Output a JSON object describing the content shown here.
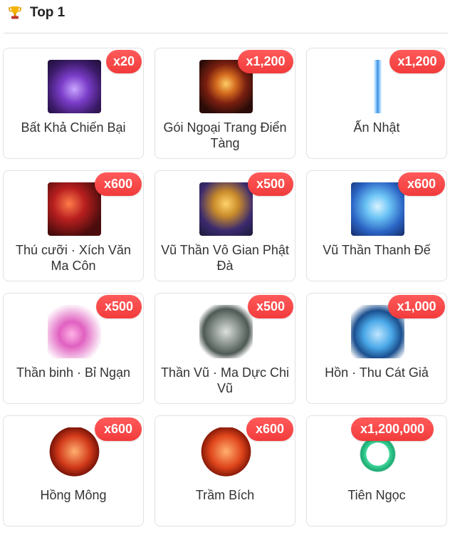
{
  "header": {
    "title": "Top 1",
    "icon": "trophy-icon"
  },
  "colors": {
    "badge": "#f23b3b",
    "border": "#e1e1e1",
    "text": "#333333"
  },
  "items": [
    {
      "name": "Bất Khả Chiến Bại",
      "qty": "x20",
      "art": "violet"
    },
    {
      "name": "Gói Ngoại Trang Điển Tàng",
      "qty": "x1,200",
      "art": "chest"
    },
    {
      "name": "Ấn Nhật",
      "qty": "x1,200",
      "art": "blade"
    },
    {
      "name": "Thú cưỡi · Xích Văn Ma Côn",
      "qty": "x600",
      "art": "red"
    },
    {
      "name": "Vũ Thần Vô Gian Phật Đà",
      "qty": "x500",
      "art": "monk"
    },
    {
      "name": "Vũ Thần Thanh Đế",
      "qty": "x600",
      "art": "blue"
    },
    {
      "name": "Thần binh · Bỉ Ngạn",
      "qty": "x500",
      "art": "pink"
    },
    {
      "name": "Thần Vũ · Ma Dực Chi Vũ",
      "qty": "x500",
      "art": "wing"
    },
    {
      "name": "Hồn · Thu Cát Giả",
      "qty": "x1,000",
      "art": "ice"
    },
    {
      "name": "Hồng Mông",
      "qty": "x600",
      "art": "orb1"
    },
    {
      "name": "Trầm Bích",
      "qty": "x600",
      "art": "orb2"
    },
    {
      "name": "Tiên Ngọc",
      "qty": "x1,200,000",
      "art": "jade"
    }
  ]
}
